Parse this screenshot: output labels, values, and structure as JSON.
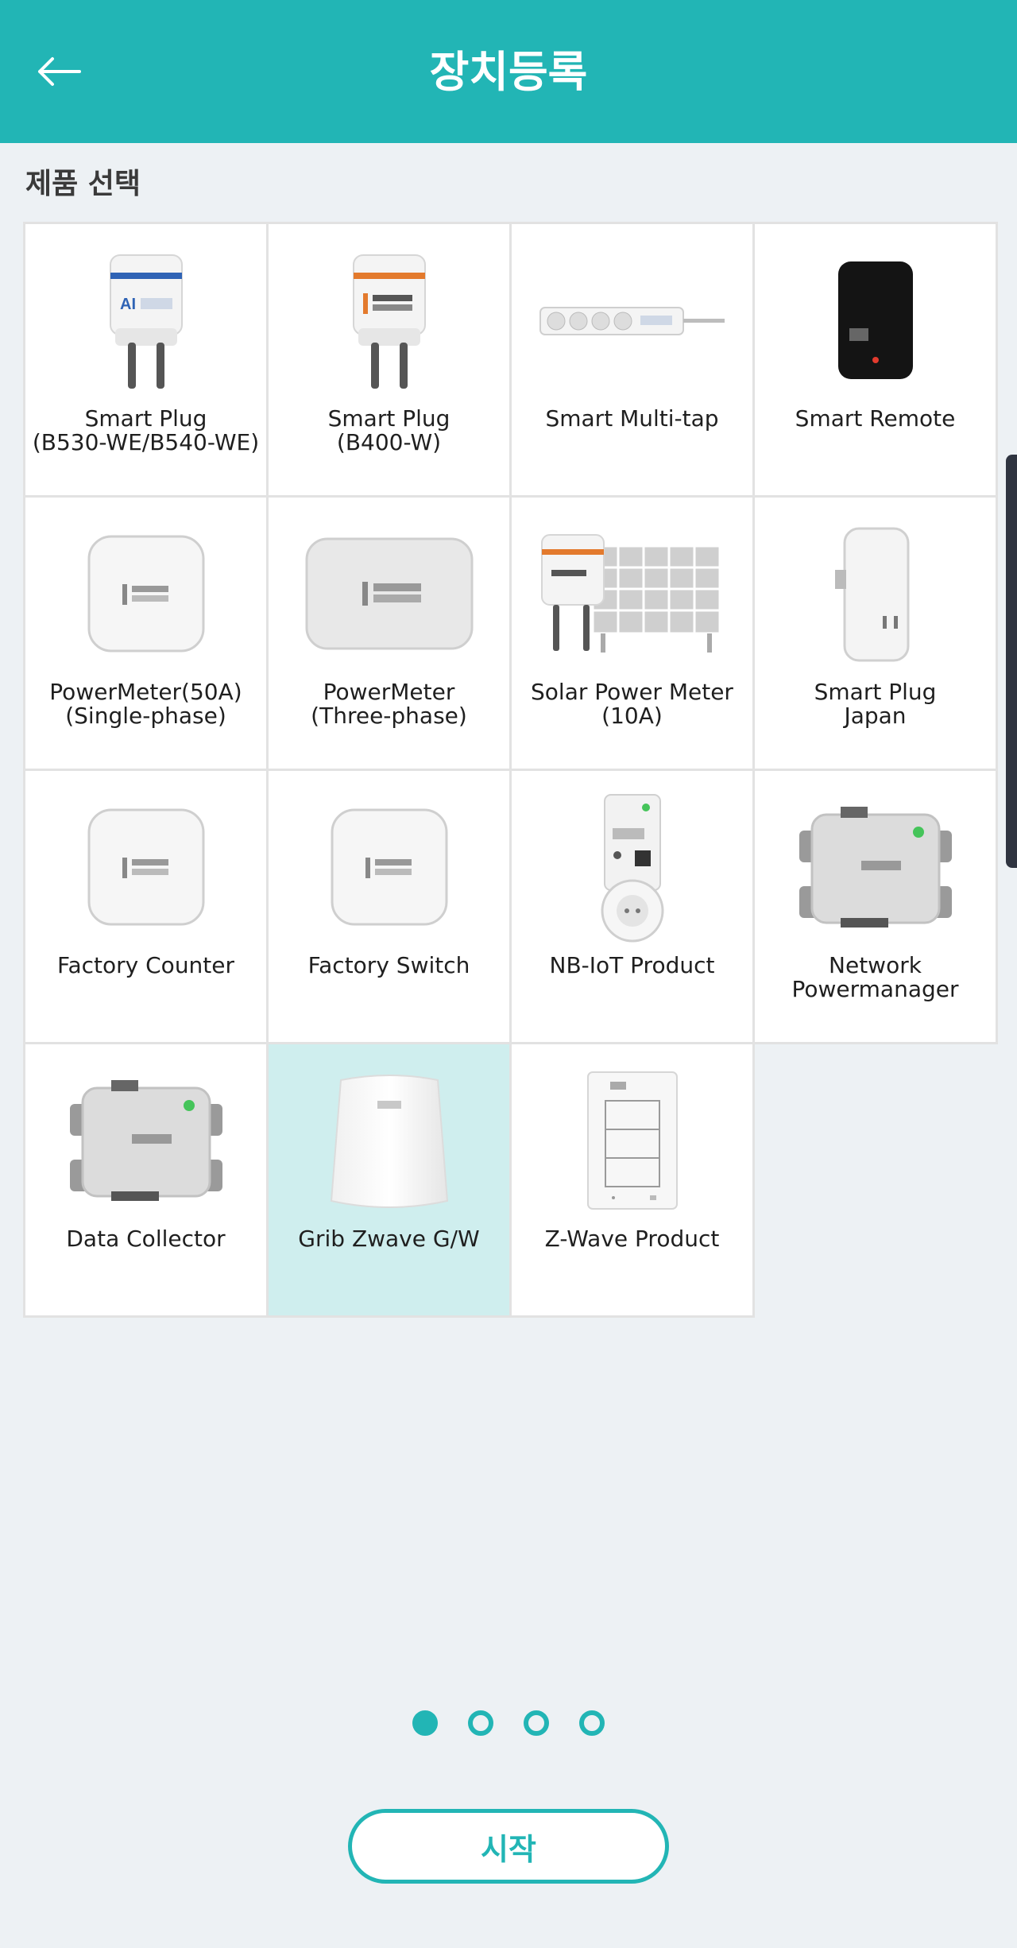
{
  "header": {
    "title": "장치등록",
    "back_icon": "arrow-left-icon"
  },
  "section": {
    "title": "제품 선택"
  },
  "products": [
    {
      "label": "Smart Plug\n(B530-WE/B540-WE)",
      "icon": "smart-plug-blue-icon",
      "selected": false
    },
    {
      "label": "Smart Plug\n(B400-W)",
      "icon": "smart-plug-orange-icon",
      "selected": false
    },
    {
      "label": "Smart Multi-tap",
      "icon": "multi-tap-icon",
      "selected": false
    },
    {
      "label": "Smart Remote",
      "icon": "smart-remote-icon",
      "selected": false
    },
    {
      "label": "PowerMeter(50A)\n(Single-phase)",
      "icon": "powermeter-single-icon",
      "selected": false
    },
    {
      "label": "PowerMeter\n(Three-phase)",
      "icon": "powermeter-three-icon",
      "selected": false
    },
    {
      "label": "Solar Power Meter\n(10A)",
      "icon": "solar-meter-icon",
      "selected": false
    },
    {
      "label": "Smart Plug\nJapan",
      "icon": "smart-plug-japan-icon",
      "selected": false
    },
    {
      "label": "Factory Counter",
      "icon": "factory-counter-icon",
      "selected": false
    },
    {
      "label": "Factory Switch",
      "icon": "factory-switch-icon",
      "selected": false
    },
    {
      "label": "NB-IoT Product",
      "icon": "nb-iot-plug-icon",
      "selected": false
    },
    {
      "label": "Network\nPowermanager",
      "icon": "network-pm-icon",
      "selected": false
    },
    {
      "label": "Data Collector",
      "icon": "data-collector-icon",
      "selected": false
    },
    {
      "label": "Grib Zwave G/W",
      "icon": "zwave-gateway-icon",
      "selected": true
    },
    {
      "label": "Z-Wave Product",
      "icon": "zwave-switch-icon",
      "selected": false
    }
  ],
  "pagination": {
    "pages": 4,
    "current": 1
  },
  "start_button": {
    "label": "시작"
  },
  "colors": {
    "accent": "#22b5b5",
    "selected_bg": "#cfeeee",
    "background": "#edf1f4"
  }
}
